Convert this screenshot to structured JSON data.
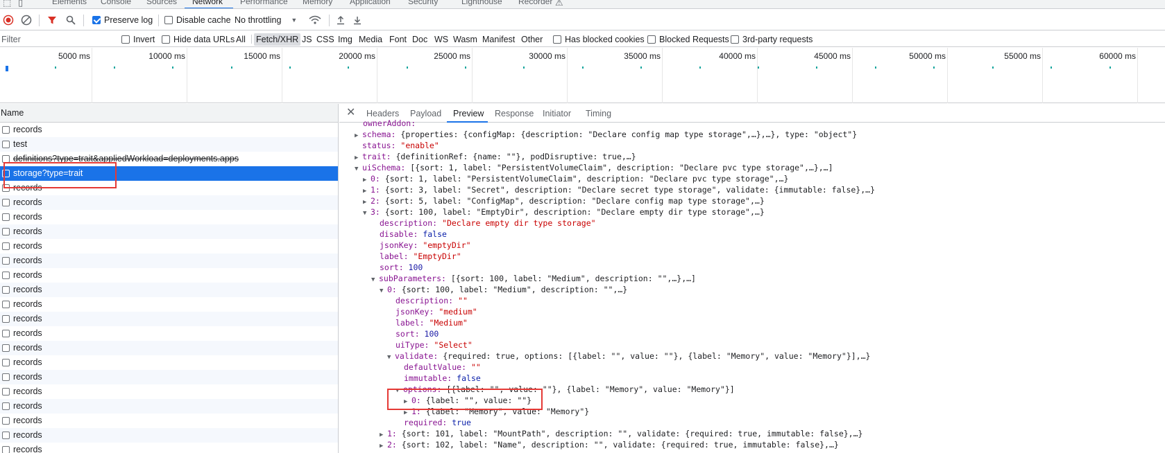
{
  "top_tabs": [
    "Elements",
    "Console",
    "Sources",
    "Network",
    "Performance",
    "Memory",
    "Application",
    "Security",
    "Lighthouse",
    "Recorder"
  ],
  "active_top_tab": "Network",
  "toolbar": {
    "preserve_log": "Preserve log",
    "disable_cache": "Disable cache",
    "throttling": "No throttling"
  },
  "filter": {
    "placeholder": "Filter",
    "invert": "Invert",
    "hide_data_urls": "Hide data URLs",
    "types": [
      "All",
      "Fetch/XHR",
      "JS",
      "CSS",
      "Img",
      "Media",
      "Font",
      "Doc",
      "WS",
      "Wasm",
      "Manifest",
      "Other"
    ],
    "active_type": "Fetch/XHR",
    "blocked_cookies": "Has blocked cookies",
    "blocked_requests": "Blocked Requests",
    "third_party": "3rd-party requests"
  },
  "overview_ticks": [
    "5000 ms",
    "10000 ms",
    "15000 ms",
    "20000 ms",
    "25000 ms",
    "30000 ms",
    "35000 ms",
    "40000 ms",
    "45000 ms",
    "50000 ms",
    "55000 ms",
    "60000 ms"
  ],
  "requests": {
    "header": "Name",
    "items": [
      "records",
      "test",
      "definitions?type=trait&appliedWorkload=deployments.apps",
      "storage?type=trait",
      "records",
      "records",
      "records",
      "records",
      "records",
      "records",
      "records",
      "records",
      "records",
      "records",
      "records",
      "records",
      "records",
      "records",
      "records",
      "records",
      "records",
      "records",
      "records"
    ],
    "selected_index": 3
  },
  "detail_tabs": [
    "Headers",
    "Payload",
    "Preview",
    "Response",
    "Initiator",
    "Timing"
  ],
  "active_detail_tab": "Preview",
  "preview": {
    "l0": "ownerAddon:",
    "l1a": "schema:",
    "l1b": " {properties: {configMap: {description: \"Declare config map type storage\",…},…}, type: \"object\"}",
    "l2a": "status:",
    "l2b": " \"enable\"",
    "l3a": "trait:",
    "l3b": " {definitionRef: {name: \"\"}, podDisruptive: true,…}",
    "l4a": "uiSchema:",
    "l4b": " [{sort: 1, label: \"PersistentVolumeClaim\", description: \"Declare pvc type storage\",…},…]",
    "l5a": "0:",
    "l5b": " {sort: 1, label: \"PersistentVolumeClaim\", description: \"Declare pvc type storage\",…}",
    "l6a": "1:",
    "l6b": " {sort: 3, label: \"Secret\", description: \"Declare secret type storage\", validate: {immutable: false},…}",
    "l7a": "2:",
    "l7b": " {sort: 5, label: \"ConfigMap\", description: \"Declare config map type storage\",…}",
    "l8a": "3:",
    "l8b": " {sort: 100, label: \"EmptyDir\", description: \"Declare empty dir type storage\",…}",
    "l9a": "description:",
    "l9b": " \"Declare empty dir type storage\"",
    "l10a": "disable:",
    "l10b": " false",
    "l11a": "jsonKey:",
    "l11b": " \"emptyDir\"",
    "l12a": "label:",
    "l12b": " \"EmptyDir\"",
    "l13a": "sort:",
    "l13b": " 100",
    "l14a": "subParameters:",
    "l14b": " [{sort: 100, label: \"Medium\", description: \"\",…},…]",
    "l15a": "0:",
    "l15b": " {sort: 100, label: \"Medium\", description: \"\",…}",
    "l16a": "description:",
    "l16b": " \"\"",
    "l17a": "jsonKey:",
    "l17b": " \"medium\"",
    "l18a": "label:",
    "l18b": " \"Medium\"",
    "l19a": "sort:",
    "l19b": " 100",
    "l20a": "uiType:",
    "l20b": " \"Select\"",
    "l21a": "validate:",
    "l21b": " {required: true, options: [{label: \"\", value: \"\"}, {label: \"Memory\", value: \"Memory\"}],…}",
    "l22a": "defaultValue:",
    "l22b": " \"\"",
    "l23a": "immutable:",
    "l23b": " false",
    "l24a": "options:",
    "l24b": " [{label: \"\", value: \"\"}, {label: \"Memory\", value: \"Memory\"}]",
    "l25a": "0:",
    "l25b": " {label: \"\", value: \"\"}",
    "l26a": "1:",
    "l26b": " {label: \"Memory\", value: \"Memory\"}",
    "l27a": "required:",
    "l27b": " true",
    "l28a": "1:",
    "l28b": " {sort: 101, label: \"MountPath\", description: \"\", validate: {required: true, immutable: false},…}",
    "l29a": "2:",
    "l29b": " {sort: 102, label: \"Name\", description: \"\", validate: {required: true, immutable: false},…}"
  },
  "colors": {
    "accent": "#1a73e8",
    "annotation": "#e53935"
  }
}
